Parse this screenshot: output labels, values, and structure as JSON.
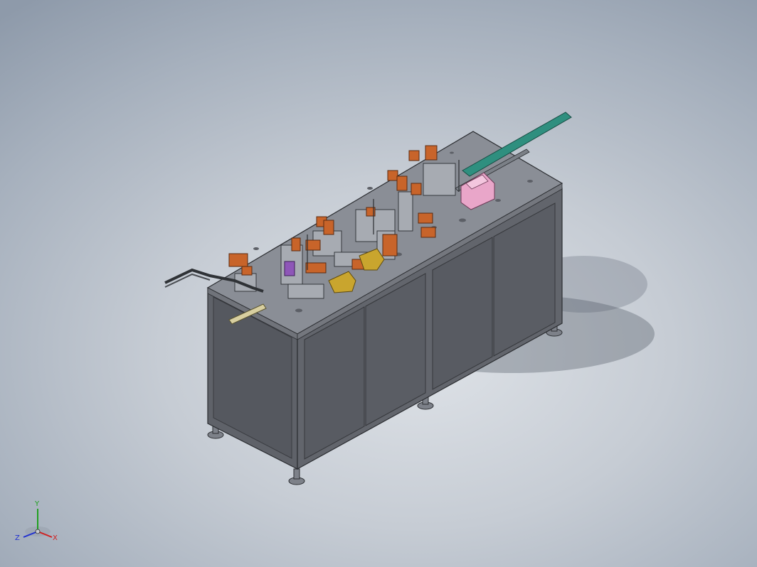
{
  "viewport": {
    "background_top": "#8e9aaa",
    "background_bottom": "#dfe3e8"
  },
  "model": {
    "frame_color": "#6a6d73",
    "panel_color": "#5f6269",
    "top_plate_color": "#8a8e96",
    "actuator_color": "#c8642a",
    "rail_color": "#2f8f7f",
    "fixture_color": "#e9a6c9",
    "gold_block_color": "#c9a52e",
    "purple_part_color": "#8e56b8"
  },
  "triad": {
    "x_label": "X",
    "y_label": "Y",
    "z_label": "Z",
    "x_color": "#d02020",
    "y_color": "#20a020",
    "z_color": "#2030d0"
  }
}
